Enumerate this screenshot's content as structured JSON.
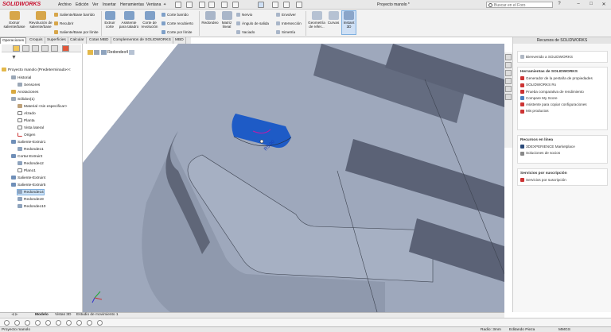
{
  "app": {
    "logo": "SOLIDWORKS",
    "doc_title": "Proyecto manolo *"
  },
  "menu": [
    "Archivo",
    "Edición",
    "Ver",
    "Insertar",
    "Herramientas",
    "Ventana",
    "Fijar"
  ],
  "search": {
    "placeholder": "Buscar en el Foro"
  },
  "ribbon": {
    "extrude_boss": "Extruir saliente/base",
    "revolve_boss": "Revolución de saliente/base",
    "swept_boss": "Saliente/Base barrido",
    "lofted_boss": "Recubrir",
    "boundary_boss": "Saliente/Base por límite",
    "extruded_cut": "Extruir corte",
    "hole_wizard": "Asistente para taladro",
    "revolved_cut": "Corte de revolución",
    "swept_cut": "Corte barrido",
    "lofted_cut": "Corte recubierto",
    "boundary_cut": "Corte por límite",
    "fillet": "Redondeo",
    "linear_pattern": "Matriz lineal",
    "rib": "Nervio",
    "draft": "Ángulo de salida",
    "shell": "Vaciado",
    "wrap": "Envolver",
    "intersect": "Intersección",
    "mirror": "Simetría",
    "ref_geometry": "Geometría de refer...",
    "curves": "Curvas",
    "instant3d": "Instant 3D"
  },
  "tabs": [
    "Operaciones",
    "Croquis",
    "Superficies",
    "Calcular",
    "Cotas MBD",
    "Complementos de SOLIDWORKS",
    "MBD"
  ],
  "tree": {
    "root": "Proyecto manolo  (Predeterminado<<",
    "items": [
      "Historial",
      "Sensores",
      "Anotaciones",
      "Sólidos(1)",
      "Material <sin especificar>",
      "Alzado",
      "Planta",
      "Vista lateral",
      "Origen",
      "Saliente-Extruir1",
      "Redondeo1",
      "Cortar-Extruir2",
      "Redondeo2",
      "Plano1",
      "Saliente-Extruir4",
      "Saliente-Extruir5",
      "Redondeo4",
      "Redondeo9",
      "Redondeo10"
    ]
  },
  "viewport": {
    "breadcrumb": "Redondeo4",
    "dimension": "R5.00"
  },
  "resources": {
    "header": "Recursos de SOLIDWORKS",
    "welcome": "Bienvenido a SOLIDWORKS",
    "tools_title": "Herramientas de SOLIDWORKS",
    "tools": [
      "Generador de la pestaña de propiedades",
      "SOLIDWORKS Rx",
      "Prueba comparativa de rendimiento",
      "Compare My Score",
      "Asistente para copiar configuraciones",
      "Mis productos"
    ],
    "online_title": "Recursos en línea",
    "online": [
      "3DEXPERIENCE Marketplace",
      "Soluciones de socios"
    ],
    "sub_title": "Servicios por suscripción",
    "sub": [
      "Servicios por suscripción"
    ]
  },
  "bottom_tabs": [
    "Modelo",
    "Vistas 3D",
    "Estudio de movimiento 1"
  ],
  "status": {
    "left": "Proyecto manolo",
    "radius": "Radio: 3mm",
    "editing": "Editando Pieza",
    "units": "MMGS"
  },
  "colors": {
    "accent": "#c8102e",
    "selection_blue": "#1e5bc6",
    "model_face": "#9da7bb"
  }
}
